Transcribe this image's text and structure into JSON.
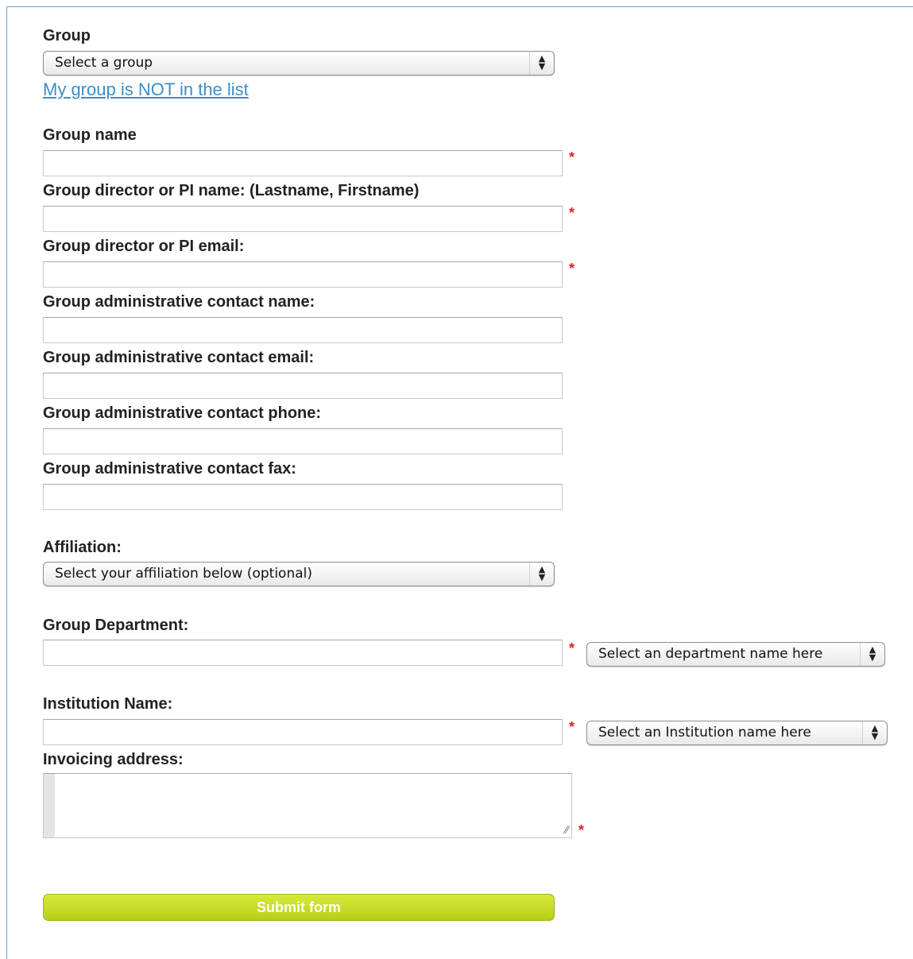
{
  "group": {
    "label": "Group",
    "select_value": "Select a group",
    "not_in_list_link": "My group is NOT in the list"
  },
  "fields": {
    "group_name": {
      "label": "Group name",
      "value": "",
      "required": "*"
    },
    "director_name": {
      "label": "Group director or PI name: (Lastname, Firstname)",
      "value": "",
      "required": "*"
    },
    "director_email": {
      "label": "Group director or PI email:",
      "value": "",
      "required": "*"
    },
    "admin_name": {
      "label": "Group administrative contact name:",
      "value": ""
    },
    "admin_email": {
      "label": "Group administrative contact email:",
      "value": ""
    },
    "admin_phone": {
      "label": "Group administrative contact phone:",
      "value": ""
    },
    "admin_fax": {
      "label": "Group administrative contact fax:",
      "value": ""
    }
  },
  "affiliation": {
    "label": "Affiliation:",
    "select_value": "Select your affiliation below (optional)"
  },
  "department": {
    "label": "Group Department:",
    "value": "",
    "required": "*",
    "select_value": "Select an department name here"
  },
  "institution": {
    "label": "Institution Name:",
    "value": "",
    "required": "*",
    "select_value": "Select an Institution name here"
  },
  "invoicing": {
    "label": "Invoicing address:",
    "value": "",
    "required": "*"
  },
  "submit": {
    "label": "Submit form"
  },
  "icons": {
    "select_arrows_up": "▲",
    "select_arrows_down": "▼",
    "resize_grip": "⁄⁄"
  },
  "colors": {
    "link": "#3a8fc8",
    "required": "#e02020",
    "submit_bg": "#c6dc28",
    "frame_border": "#6a9ed8"
  }
}
